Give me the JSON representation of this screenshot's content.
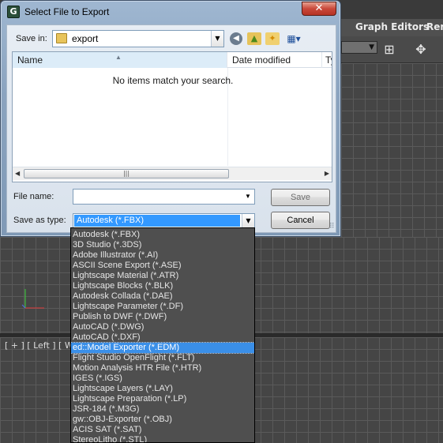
{
  "app": {
    "menu": [
      "Graph Editors",
      "Ren"
    ],
    "toolbar_dropdown": "",
    "viewport_label": "[ + ] [ Left ] [ Wire"
  },
  "dialog": {
    "title": "Select File to Export",
    "close_glyph": "✕",
    "save_in_label": "Save in:",
    "save_in_value": "export",
    "columns": [
      "Name",
      "Date modified",
      "Ty"
    ],
    "empty_message": "No items match your search.",
    "file_name_label": "File name:",
    "file_name_value": "",
    "save_as_type_label": "Save as type:",
    "save_as_type_value": "Autodesk (*.FBX)",
    "save_button": "Save",
    "cancel_button": "Cancel",
    "icons": [
      "back-icon",
      "up-folder-icon",
      "new-folder-icon",
      "view-menu-icon",
      "folder-icon"
    ]
  },
  "file_types": [
    "Autodesk (*.FBX)",
    "3D Studio (*.3DS)",
    "Adobe Illustrator (*.AI)",
    "ASCII Scene Export (*.ASE)",
    "Lightscape Material (*.ATR)",
    "Lightscape Blocks (*.BLK)",
    "Autodesk Collada (*.DAE)",
    "Lightscape Parameter (*.DF)",
    "Publish to DWF (*.DWF)",
    "AutoCAD (*.DWG)",
    "AutoCAD (*.DXF)",
    "ed::Model Exporter (*.EDM)",
    "Flight Studio OpenFlight (*.FLT)",
    "Motion Analysis HTR File (*.HTR)",
    "IGES (*.IGS)",
    "Lightscape Layers (*.LAY)",
    "Lightscape Preparation (*.LP)",
    "JSR-184 (*.M3G)",
    "gw::OBJ-Exporter (*.OBJ)",
    "ACIS SAT (*.SAT)",
    "StereoLitho (*.STL)"
  ],
  "selected_file_type_index": 11,
  "colors": {
    "selection": "#3a8fe8",
    "dropdown_bg": "#4f4f4f",
    "viewport_grid": "#5a5a5a"
  }
}
